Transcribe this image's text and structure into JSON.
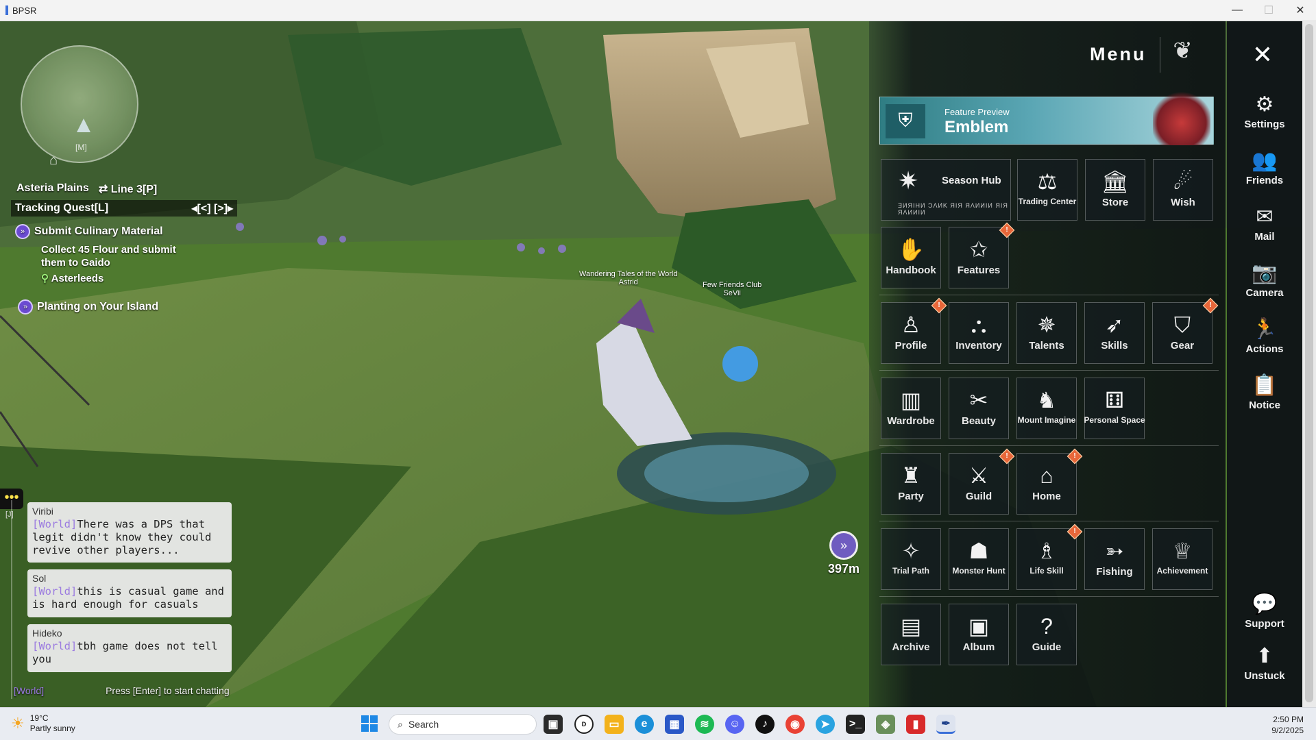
{
  "window": {
    "title": "BPSR",
    "minimize": "—",
    "maximize": "☐",
    "close": "✕"
  },
  "hud": {
    "minimap_key": "[M]",
    "zone": "Asteria Plains",
    "line": "Line 3[P]",
    "tracking": "Tracking Quest[L]",
    "tracking_nav": "◂[<]   [>]▸",
    "quests": [
      {
        "title": "Submit Culinary Material",
        "desc_1": "Collect 45 Flour and submit",
        "desc_2": "them to Gaido",
        "location": "Asterleeds"
      },
      {
        "title": "Planting on Your Island"
      }
    ],
    "nameplates": [
      {
        "guild": "Wandering Tales of the World",
        "name": "Astrid"
      },
      {
        "guild": "Few Friends Club",
        "name": "SeVii"
      }
    ],
    "waypoint_distance": "397m"
  },
  "chat": {
    "key": "[J]",
    "messages": [
      {
        "user": "Viribi",
        "channel": "[World]",
        "text": "There was a DPS that legit didn't know they could revive other players..."
      },
      {
        "user": "Sol",
        "channel": "[World]",
        "text": "this is casual game and is hard enough for casuals"
      },
      {
        "user": "Hideko",
        "channel": "[World]",
        "text": "tbh game does not tell you"
      }
    ],
    "channel": "[World]",
    "prompt": "Press [Enter] to start chatting"
  },
  "menu": {
    "title": "Menu",
    "feature_preview": "Feature Preview",
    "feature_name": "Emblem",
    "season_hub": "Season Hub",
    "season_sub": "ƎИЯIHИ ƆΛИK ЯIЯ ЯΛИИIИ ЯIЯ ЯΛИИIИ",
    "rows": [
      [
        "Trading Center",
        "Store",
        "Wish"
      ],
      [
        "Handbook",
        "Features"
      ],
      [
        "Profile",
        "Inventory",
        "Talents",
        "Skills",
        "Gear"
      ],
      [
        "Wardrobe",
        "Beauty",
        "Mount Imagine",
        "Personal Space"
      ],
      [
        "Party",
        "Guild",
        "Home"
      ],
      [
        "Trial Path",
        "Monster Hunt",
        "Life Skill",
        "Fishing",
        "Achievement"
      ],
      [
        "Archive",
        "Album",
        "Guide"
      ]
    ]
  },
  "sidebar": {
    "items": [
      "Settings",
      "Friends",
      "Mail",
      "Camera",
      "Actions",
      "Notice",
      "Support",
      "Unstuck"
    ]
  },
  "taskbar": {
    "temp": "19°C",
    "weather": "Partly sunny",
    "search_placeholder": "Search",
    "time": "2:50 PM",
    "date": "9/2/2025"
  }
}
